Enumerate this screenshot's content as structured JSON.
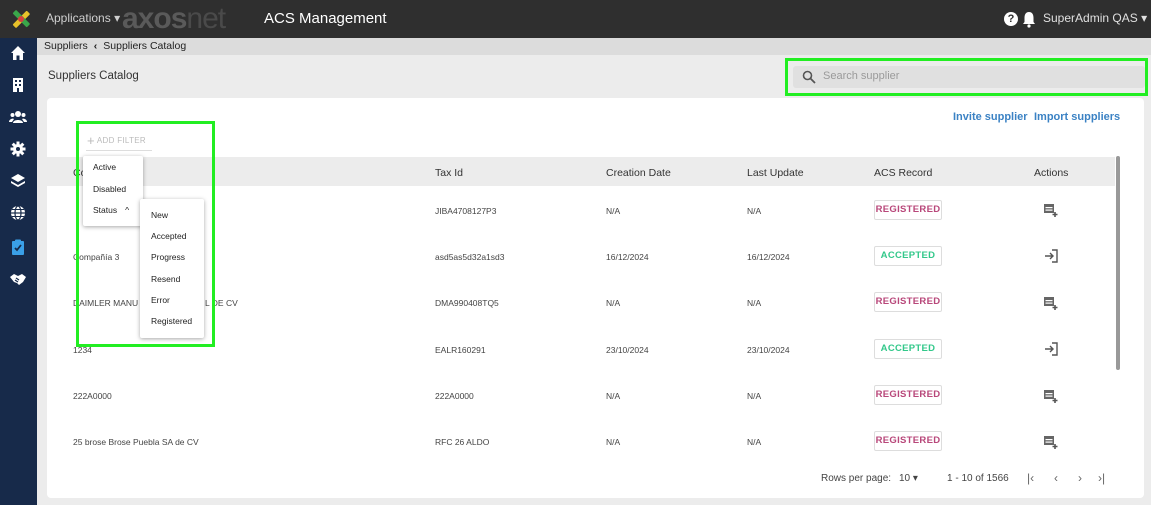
{
  "topbar": {
    "applications_label": "Applications",
    "brand_a": "axos",
    "brand_b": "net",
    "title": "ACS Management",
    "help_glyph": "?",
    "user_label": "SuperAdmin QAS"
  },
  "breadcrumb": {
    "parent": "Suppliers",
    "current": "Suppliers Catalog"
  },
  "page_title": "Suppliers Catalog",
  "search": {
    "placeholder": "Search supplier"
  },
  "actions": {
    "invite": "Invite supplier",
    "import": "Import suppliers"
  },
  "filter": {
    "add_label": "ADD FILTER",
    "menu": [
      "Active",
      "Disabled",
      "Status"
    ],
    "status_options": [
      "New",
      "Accepted",
      "Progress",
      "Resend",
      "Error",
      "Registered"
    ]
  },
  "table": {
    "headers": [
      "Co",
      "Tax Id",
      "Creation Date",
      "Last Update",
      "ACS Record",
      "Actions"
    ],
    "rows": [
      {
        "company": "",
        "tax_id": "JIBA4708127P3",
        "created": "N/A",
        "updated": "N/A",
        "record": "REGISTERED"
      },
      {
        "company": "Compañía 3",
        "tax_id": "asd5as5d32a1sd3",
        "created": "16/12/2024",
        "updated": "16/12/2024",
        "record": "ACCEPTED"
      },
      {
        "company_a": "DAIMLER MANU",
        "company_b": "L DE CV",
        "tax_id": "DMA990408TQ5",
        "created": "N/A",
        "updated": "N/A",
        "record": "REGISTERED"
      },
      {
        "company": "1234",
        "tax_id": "EALR160291",
        "created": "23/10/2024",
        "updated": "23/10/2024",
        "record": "ACCEPTED"
      },
      {
        "company": "222A0000",
        "tax_id": "222A0000",
        "created": "N/A",
        "updated": "N/A",
        "record": "REGISTERED"
      },
      {
        "company": "25 brose Brose Puebla SA de CV",
        "tax_id": "RFC 26 ALDO",
        "created": "N/A",
        "updated": "N/A",
        "record": "REGISTERED"
      }
    ]
  },
  "pagination": {
    "rows_per_page_label": "Rows per page:",
    "rows_per_page": "10",
    "range": "1 - 10 of 1566"
  },
  "colors": {
    "highlight": "#22ee22",
    "sidebar": "#172a4a",
    "registered": "#b8477a",
    "accepted": "#32c88a",
    "link": "#3b82c4"
  }
}
